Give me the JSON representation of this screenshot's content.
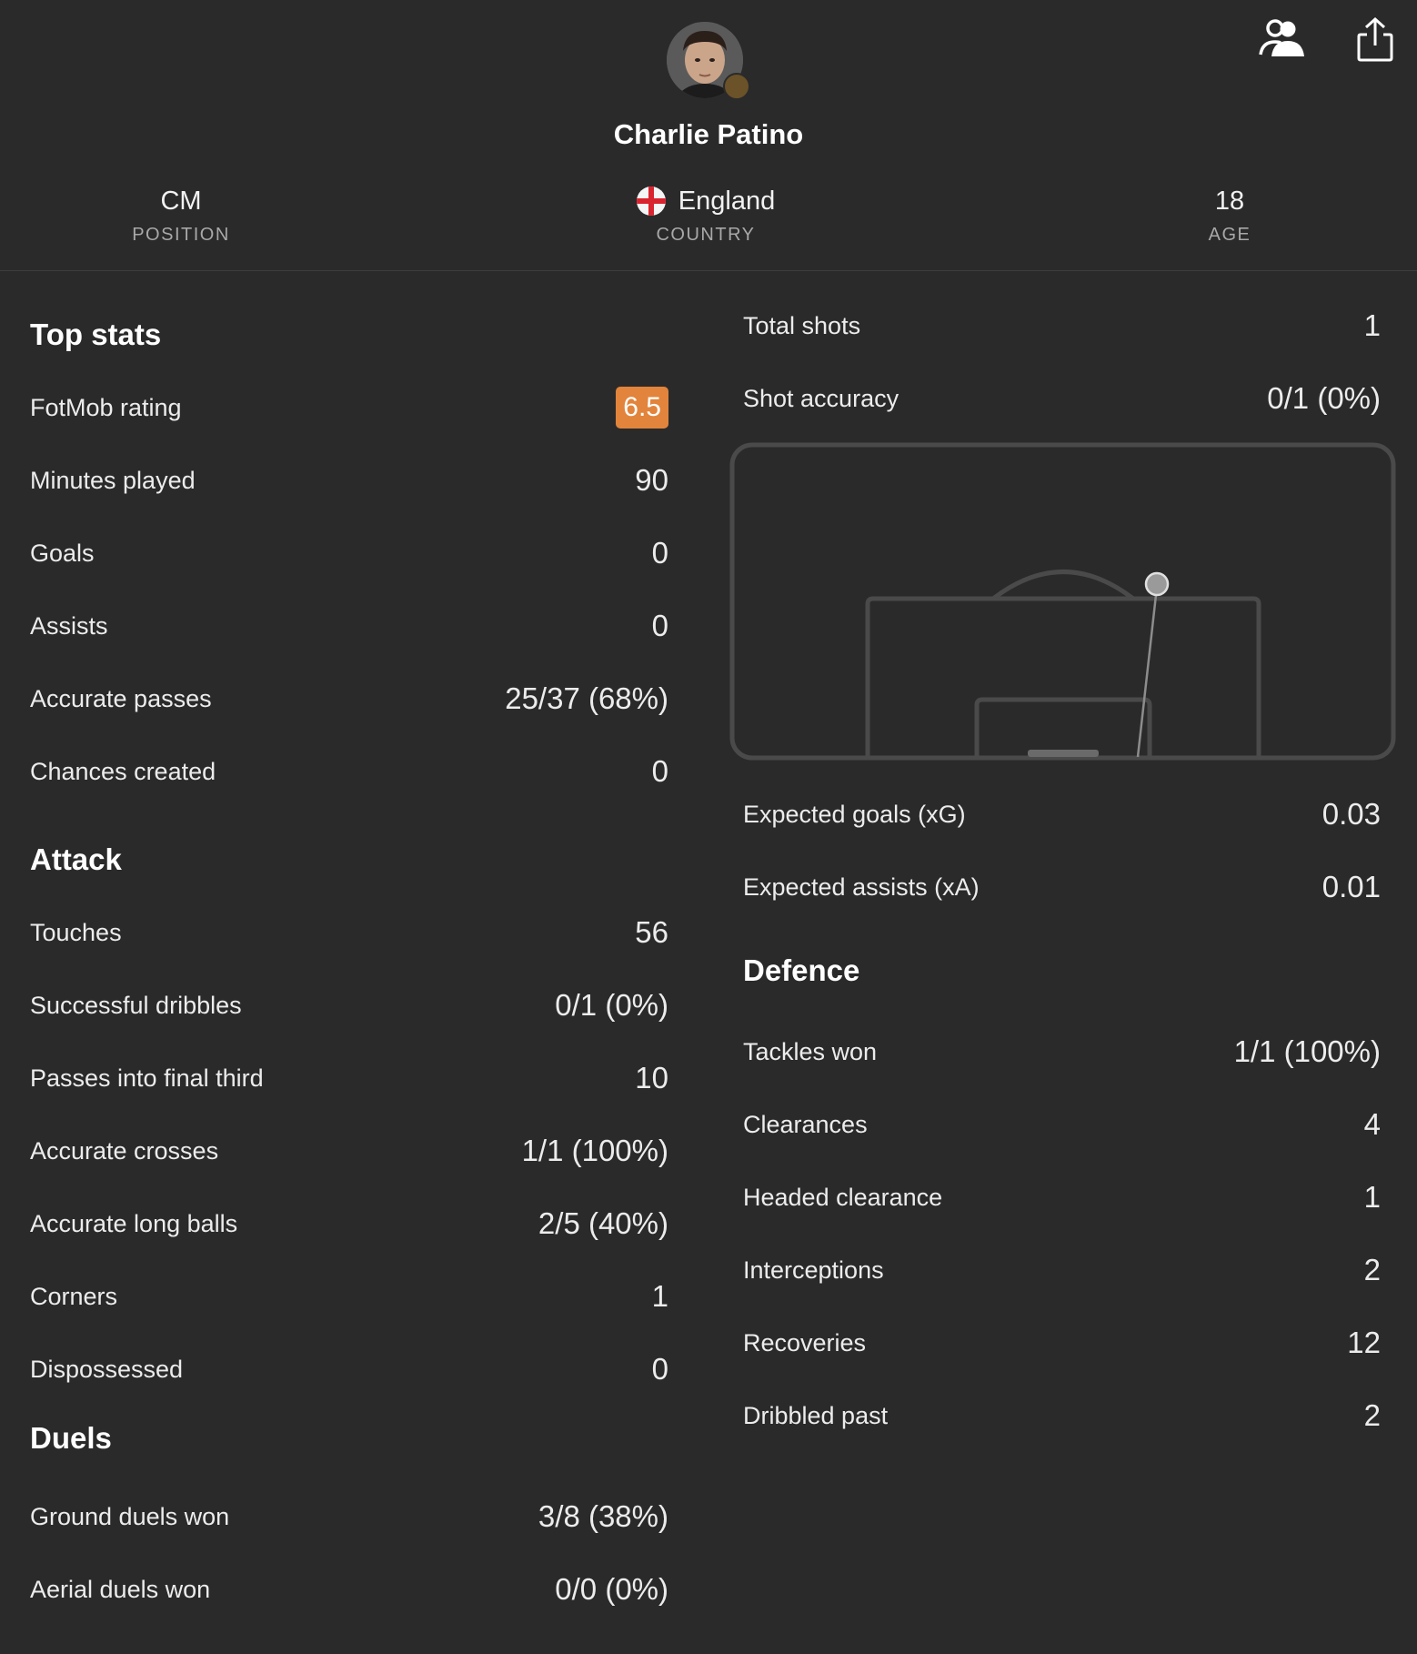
{
  "player": {
    "name": "Charlie Patino",
    "info": [
      {
        "value": "CM",
        "label": "POSITION"
      },
      {
        "value": "England",
        "label": "COUNTRY"
      },
      {
        "value": "18",
        "label": "AGE"
      }
    ]
  },
  "icons": {
    "profile": "profile-icon",
    "share": "share-icon",
    "flag": "england-flag-icon"
  },
  "colors": {
    "background": "#2a2a2a",
    "rating_badge": "#e2843b",
    "pitch_lines": "#4a4a4a",
    "shot_marker": "#9a9a9a"
  },
  "top_stats": {
    "title": "Top stats",
    "rows": [
      {
        "name": "FotMob rating",
        "value": "6.5"
      },
      {
        "name": "Minutes played",
        "value": "90"
      },
      {
        "name": "Goals",
        "value": "0"
      },
      {
        "name": "Assists",
        "value": "0"
      },
      {
        "name": "Accurate passes",
        "value": "25/37 (68%)"
      },
      {
        "name": "Chances created",
        "value": "0"
      }
    ]
  },
  "attack": {
    "title": "Attack",
    "rows": [
      {
        "name": "Touches",
        "value": "56"
      },
      {
        "name": "Successful dribbles",
        "value": "0/1 (0%)"
      },
      {
        "name": "Passes into final third",
        "value": "10"
      },
      {
        "name": "Accurate crosses",
        "value": "1/1 (100%)"
      },
      {
        "name": "Accurate long balls",
        "value": "2/5 (40%)"
      },
      {
        "name": "Corners",
        "value": "1"
      },
      {
        "name": "Dispossessed",
        "value": "0"
      }
    ]
  },
  "duels": {
    "title": "Duels",
    "rows": [
      {
        "name": "Ground duels won",
        "value": "3/8 (38%)"
      },
      {
        "name": "Aerial duels won",
        "value": "0/0 (0%)"
      }
    ]
  },
  "shooting": {
    "rows_top": [
      {
        "name": "Total shots",
        "value": "1"
      },
      {
        "name": "Shot accuracy",
        "value": "0/1 (0%)"
      }
    ],
    "rows_bottom": [
      {
        "name": "Expected goals (xG)",
        "value": "0.03"
      },
      {
        "name": "Expected assists (xA)",
        "value": "0.01"
      }
    ]
  },
  "defence": {
    "title": "Defence",
    "rows": [
      {
        "name": "Tackles won",
        "value": "1/1 (100%)"
      },
      {
        "name": "Clearances",
        "value": "4"
      },
      {
        "name": "Headed clearance",
        "value": "1"
      },
      {
        "name": "Interceptions",
        "value": "2"
      },
      {
        "name": "Recoveries",
        "value": "12"
      },
      {
        "name": "Dribbled past",
        "value": "2"
      }
    ]
  }
}
